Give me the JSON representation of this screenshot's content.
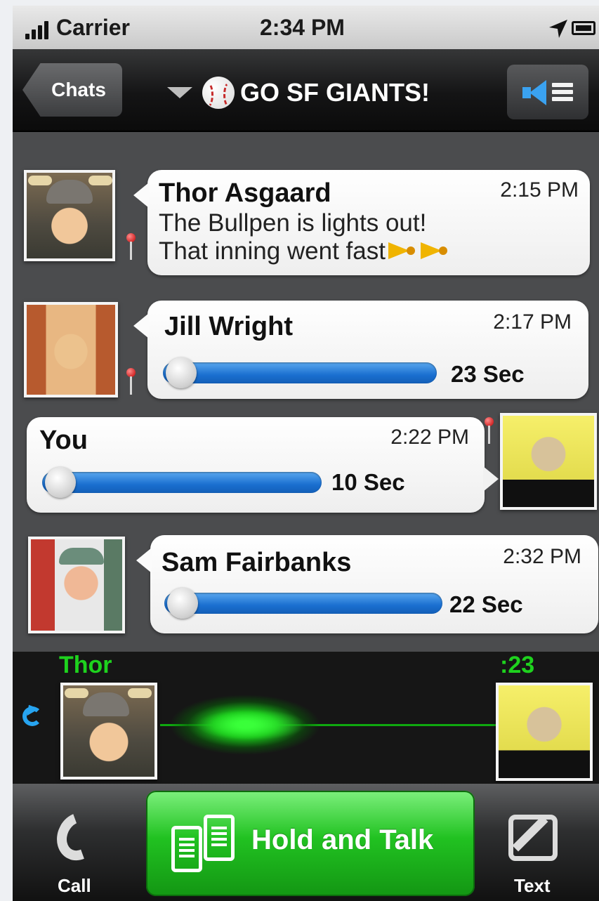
{
  "status_bar": {
    "carrier": "Carrier",
    "time": "2:34 PM"
  },
  "nav": {
    "back_label": "Chats",
    "title": "GO SF GIANTS!"
  },
  "messages": [
    {
      "sender": "Thor Asgaard",
      "time": "2:15 PM",
      "text_line1": "The Bullpen is lights out!",
      "text_line2": "That inning went fast"
    },
    {
      "sender": "Jill Wright",
      "time": "2:17 PM",
      "duration": "23 Sec",
      "progress": 0
    },
    {
      "sender": "You",
      "time": "2:22 PM",
      "duration": "10 Sec",
      "progress": 0
    },
    {
      "sender": "Sam Fairbanks",
      "time": "2:32 PM",
      "duration": "22 Sec",
      "progress": 0
    }
  ],
  "recorder": {
    "speaker": "Thor",
    "counter": ":23"
  },
  "tab_bar": {
    "call_label": "Call",
    "hold_label": "Hold and Talk",
    "text_label": "Text"
  },
  "colors": {
    "accent_green": "#1ed21e",
    "slider_blue": "#1a6fd0",
    "speaker_blue": "#3aa2f0"
  }
}
